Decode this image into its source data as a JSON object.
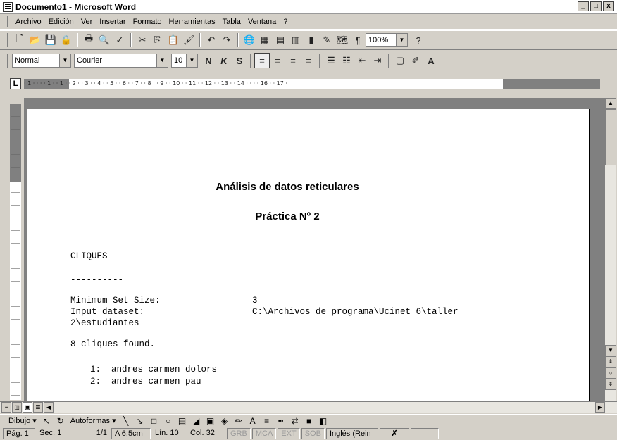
{
  "window": {
    "title": "Documento1 - Microsoft Word",
    "controls": [
      "_",
      "□",
      "x"
    ]
  },
  "menu": [
    "Archivo",
    "Edición",
    "Ver",
    "Insertar",
    "Formato",
    "Herramientas",
    "Tabla",
    "Ventana",
    "?"
  ],
  "standard_toolbar": {
    "zoom": "100%",
    "icons": [
      "new-icon",
      "open-icon",
      "save-icon",
      "permission-icon",
      "print-icon",
      "print-preview-icon",
      "spelling-icon",
      "cut-icon",
      "copy-icon",
      "paste-icon",
      "format-painter-icon",
      "undo-icon",
      "redo-icon",
      "hyperlink-icon",
      "tables-borders-icon",
      "insert-table-icon",
      "insert-excel-icon",
      "columns-icon",
      "drawing-icon",
      "document-map-icon",
      "show-formatting-icon",
      "help-icon"
    ]
  },
  "formatting_toolbar": {
    "style": "Normal",
    "font": "Courier",
    "size": "10",
    "bold": "N",
    "italic": "K",
    "underline": "S"
  },
  "ruler": {
    "numbers": "· 1 · · · · 1 · · 1 · · 2 · · 3 · · 4 · · 5 · · 6 · · 7 · · 8 · · 9 · · 10 · · 11 · · 12 · · 13 · · 14 · · · · 16 · · 17 ·"
  },
  "document": {
    "title": "Análisis de datos reticulares",
    "subtitle": "Práctica Nº 2",
    "heading": "CLIQUES",
    "rule1": "-------------------------------------------------------------",
    "rule2": "----------",
    "min_set_label": "Minimum Set Size:",
    "min_set_value": "3",
    "input_label": "Input dataset:",
    "input_value": "C:\\Archivos de programa\\Ucinet 6\\taller",
    "input_cont": "2\\estudiantes",
    "found": "8 cliques found.",
    "clique1": "1:  andres carmen dolors",
    "clique2": "2:  andres carmen pau"
  },
  "drawing_toolbar": {
    "draw": "Dibujo",
    "autoshapes": "Autoformas"
  },
  "status": {
    "page": "Pág. 1",
    "section": "Sec. 1",
    "pages": "1/1",
    "at": "A 6,5cm",
    "line": "Lín. 10",
    "col": "Col. 32",
    "rec": "GRB",
    "trk": "MCA",
    "ext": "EXT",
    "ovr": "SOB",
    "lang": "Inglés (Rein"
  }
}
